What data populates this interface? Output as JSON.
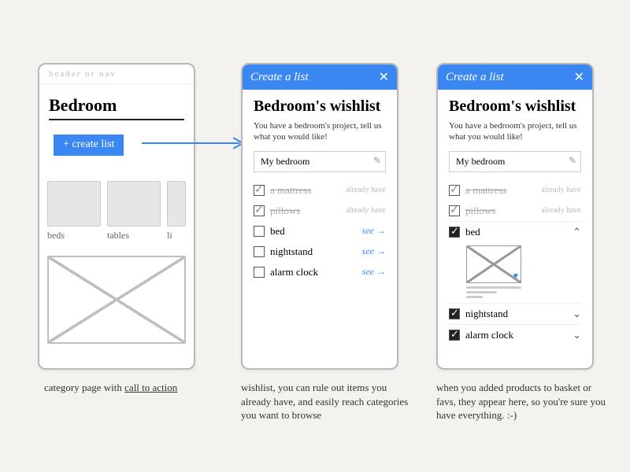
{
  "screen1": {
    "header_nav": "header  or  nav",
    "title": "Bedroom",
    "cta": "+ create list",
    "tiles": [
      "beds",
      "tables",
      "li"
    ],
    "caption": "category page with <u>call to action</u>"
  },
  "modal": {
    "title": "Create a list",
    "close": "✕",
    "heading": "Bedroom's wishlist",
    "prompt": "You have a bedroom's project, tell us what you would like!",
    "listname_value": "My bedroom"
  },
  "screen2": {
    "have": [
      {
        "name": "a mattress",
        "aside": "already have"
      },
      {
        "name": "pillows",
        "aside": "already have"
      }
    ],
    "want": [
      {
        "name": "bed",
        "see": "see →"
      },
      {
        "name": "nightstand",
        "see": "see →"
      },
      {
        "name": "alarm clock",
        "see": "see →"
      }
    ],
    "caption": "wishlist, you can rule out items you already have, and easily reach categories you want to browse"
  },
  "screen3": {
    "have": [
      {
        "name": "a mattress",
        "aside": "already have"
      },
      {
        "name": "pillows",
        "aside": "already have"
      }
    ],
    "expanded": {
      "name": "bed",
      "chev": "⌃"
    },
    "checked": [
      {
        "name": "nightstand",
        "chev": "⌄"
      },
      {
        "name": "alarm clock",
        "chev": "⌄"
      }
    ],
    "caption": "when you added products to basket or favs, they appear here, so you're sure you have everything.   :-)"
  }
}
